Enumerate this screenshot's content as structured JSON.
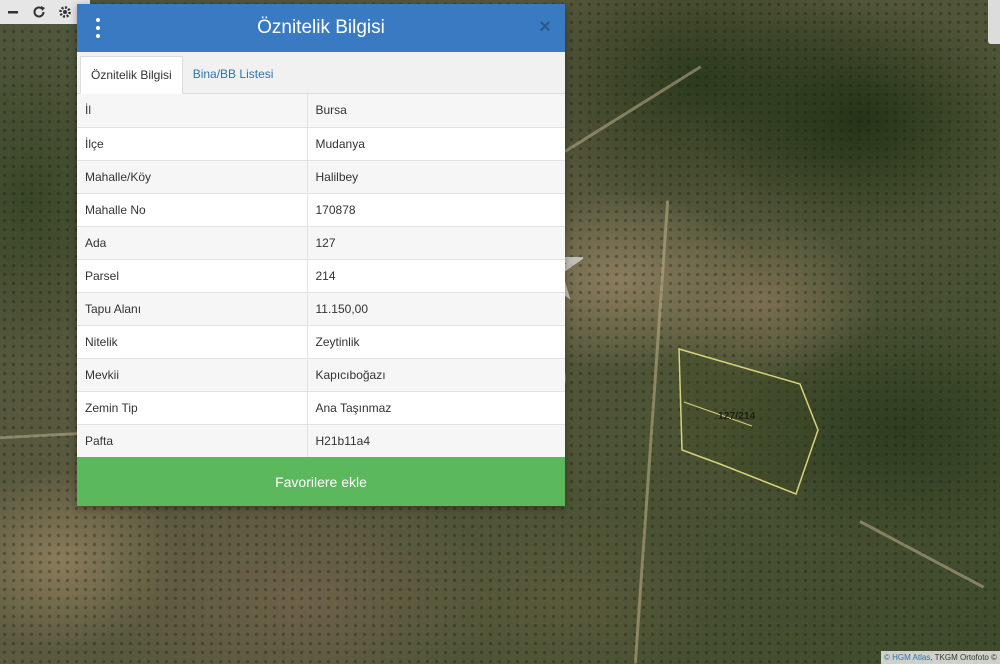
{
  "dialog": {
    "title": "Öznitelik Bilgisi",
    "close_label": "×",
    "tabs": [
      {
        "label": "Öznitelik Bilgisi",
        "active": true
      },
      {
        "label": "Bina/BB Listesi",
        "active": false
      }
    ],
    "rows": [
      {
        "key": "İl",
        "value": "Bursa"
      },
      {
        "key": "İlçe",
        "value": "Mudanya"
      },
      {
        "key": "Mahalle/Köy",
        "value": "Halilbey"
      },
      {
        "key": "Mahalle No",
        "value": "170878"
      },
      {
        "key": "Ada",
        "value": "127"
      },
      {
        "key": "Parsel",
        "value": "214"
      },
      {
        "key": "Tapu Alanı",
        "value": "11.150,00"
      },
      {
        "key": "Nitelik",
        "value": "Zeytinlik"
      },
      {
        "key": "Mevkii",
        "value": "Kapıcıboğazı"
      },
      {
        "key": "Zemin Tip",
        "value": "Ana Taşınmaz"
      },
      {
        "key": "Pafta",
        "value": "H21b11a4"
      }
    ],
    "favorite_button": "Favorilere ekle"
  },
  "map": {
    "parcel_label": "127/214",
    "attribution_link": "© HGM Atlas",
    "attribution_rest": ", TKGM Ortofoto ©",
    "toolbar_icons": [
      "minus-icon",
      "refresh-icon",
      "gear-icon"
    ]
  },
  "colors": {
    "header": "#3a7ac2",
    "favorite_button": "#5cb85c",
    "tab_link": "#2f73b5",
    "parcel_outline": "#d8d27a"
  },
  "watermark": "CB logo"
}
